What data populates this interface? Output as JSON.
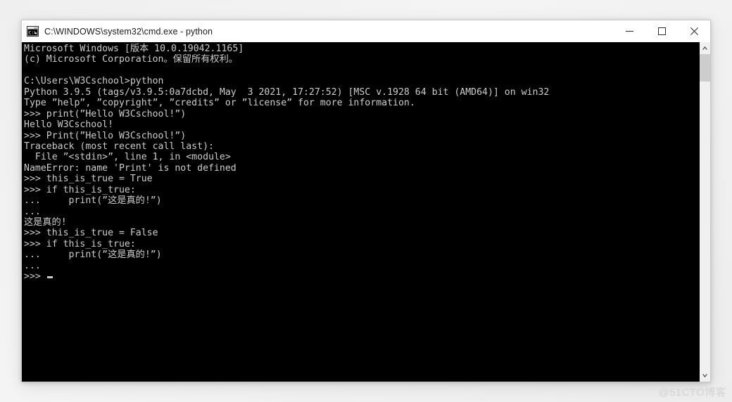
{
  "window": {
    "title": "C:\\WINDOWS\\system32\\cmd.exe - python",
    "icon": "cmd-console-icon",
    "controls": {
      "minimize_label": "—",
      "maximize_label": "☐",
      "close_label": "✕"
    }
  },
  "console": {
    "background_color": "#000000",
    "text_color": "#cccccc",
    "lines": [
      "Microsoft Windows [版本 10.0.19042.1165]",
      "(c) Microsoft Corporation。保留所有权利。",
      "",
      "C:\\Users\\W3Cschool>python",
      "Python 3.9.5 (tags/v3.9.5:0a7dcbd, May  3 2021, 17:27:52) [MSC v.1928 64 bit (AMD64)] on win32",
      "Type ”help”, ”copyright”, ”credits” or ”license” for more information.",
      ">>> print(”Hello W3Cschool!”)",
      "Hello W3Cschool!",
      ">>> Print(”Hello W3Cschool!”)",
      "Traceback (most recent call last):",
      "  File ”<stdin>”, line 1, in <module>",
      "NameError: name 'Print' is not defined",
      ">>> this_is_true = True",
      ">>> if this_is_true:",
      "...     print(”这是真的!”)",
      "...",
      "这是真的!",
      ">>> this_is_true = False",
      ">>> if this_is_true:",
      "...     print(”这是真的!”)",
      "...",
      ">>> "
    ],
    "prompt_cursor": true
  },
  "scrollbar": {
    "up_arrow": "▲",
    "down_arrow": "▼",
    "thumb_color": "#cdcdcd",
    "track_color": "#f0f0f0"
  },
  "watermark": {
    "text": "@51CTO博客"
  }
}
